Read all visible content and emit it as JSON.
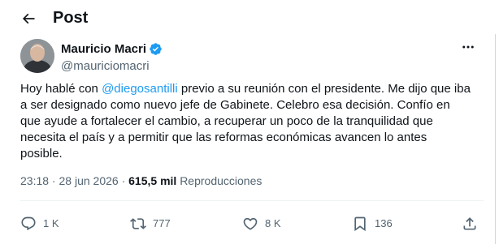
{
  "header": {
    "title": "Post"
  },
  "author": {
    "display_name": "Mauricio Macri",
    "handle": "@mauriciomacri",
    "verified_color": "#1d9bf0"
  },
  "tweet": {
    "text_before_mention": "Hoy hablé con ",
    "mention": "@diegosantilli",
    "text_line_1": " previo a su reunión con el presidente. Me dijo que iba",
    "text_line_2": "a ser designado como nuevo jefe de Gabinete. Celebro esa decisión. Confío en",
    "text_line_3": "que ayude a fortalecer el cambio, a recuperar un poco de la tranquilidad que",
    "text_line_4": "necesita el país y a permitir que las reformas económicas avancen lo antes",
    "text_line_5": "posible."
  },
  "meta": {
    "time": "23:18",
    "separator": " · ",
    "date": "28 jun 2026",
    "views_count": "615,5 mil",
    "views_label": "Reproducciones"
  },
  "actions": {
    "replies": "1 K",
    "reposts": "777",
    "likes": "8 K",
    "bookmarks": "136"
  },
  "icons": {
    "back": "arrow-left-icon",
    "verified": "verified-badge-icon",
    "more": "more-horizontal-icon",
    "reply": "reply-icon",
    "repost": "repost-icon",
    "like": "heart-icon",
    "bookmark": "bookmark-icon",
    "share": "share-icon"
  },
  "colors": {
    "text": "#0f1419",
    "secondary": "#536471",
    "link": "#1d9bf0"
  }
}
